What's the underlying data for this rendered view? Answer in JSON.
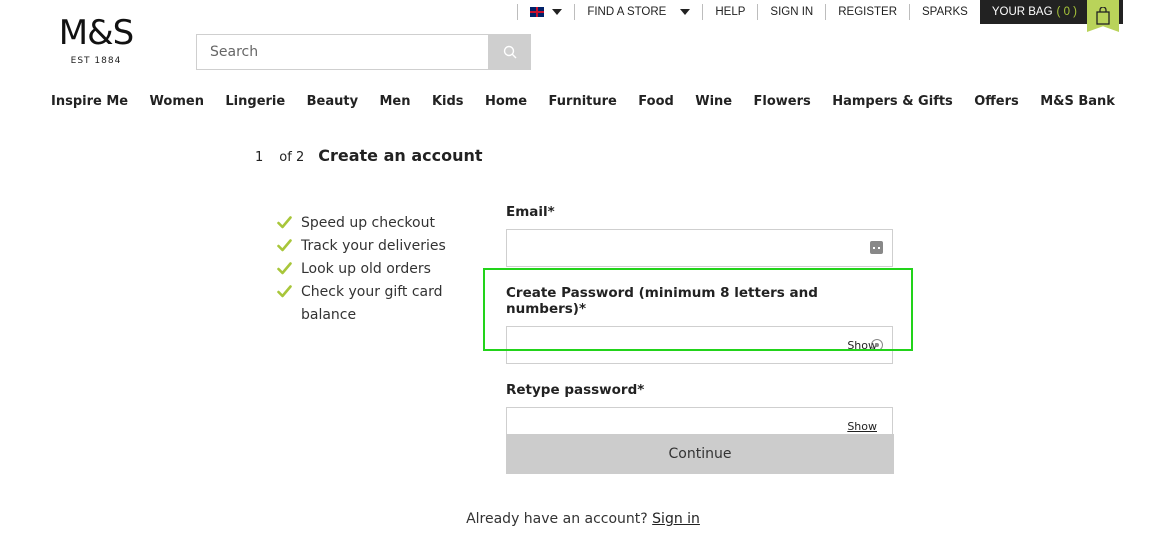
{
  "brand": {
    "logo": "M&S",
    "established": "EST 1884"
  },
  "search": {
    "placeholder": "Search"
  },
  "utility": {
    "find_store": "FIND A STORE",
    "help": "HELP",
    "sign_in": "SIGN IN",
    "register": "REGISTER",
    "sparks": "SPARKS",
    "bag_label": "YOUR BAG",
    "bag_count": "( 0 )"
  },
  "nav": [
    "Inspire Me",
    "Women",
    "Lingerie",
    "Beauty",
    "Men",
    "Kids",
    "Home",
    "Furniture",
    "Food",
    "Wine",
    "Flowers",
    "Hampers & Gifts",
    "Offers",
    "M&S Bank"
  ],
  "step": {
    "number": "1",
    "of": "of 2",
    "title": "Create an account"
  },
  "benefits": [
    "Speed up checkout",
    "Track your deliveries",
    "Look up old orders",
    "Check your gift card balance"
  ],
  "form": {
    "email_label": "Email*",
    "email_value": "",
    "password_label": "Create Password (minimum 8 letters and numbers)*",
    "password_value": "",
    "password_show": "Show",
    "retype_label": "Retype password*",
    "retype_value": "",
    "retype_show": "Show",
    "continue_label": "Continue"
  },
  "footer": {
    "have_account": "Already have an account?",
    "sign_in_link": "Sign in"
  },
  "colors": {
    "accent_green": "#a8c63a",
    "bag_bg": "#222222",
    "highlight": "#22d31a",
    "button_grey": "#cccccc"
  }
}
